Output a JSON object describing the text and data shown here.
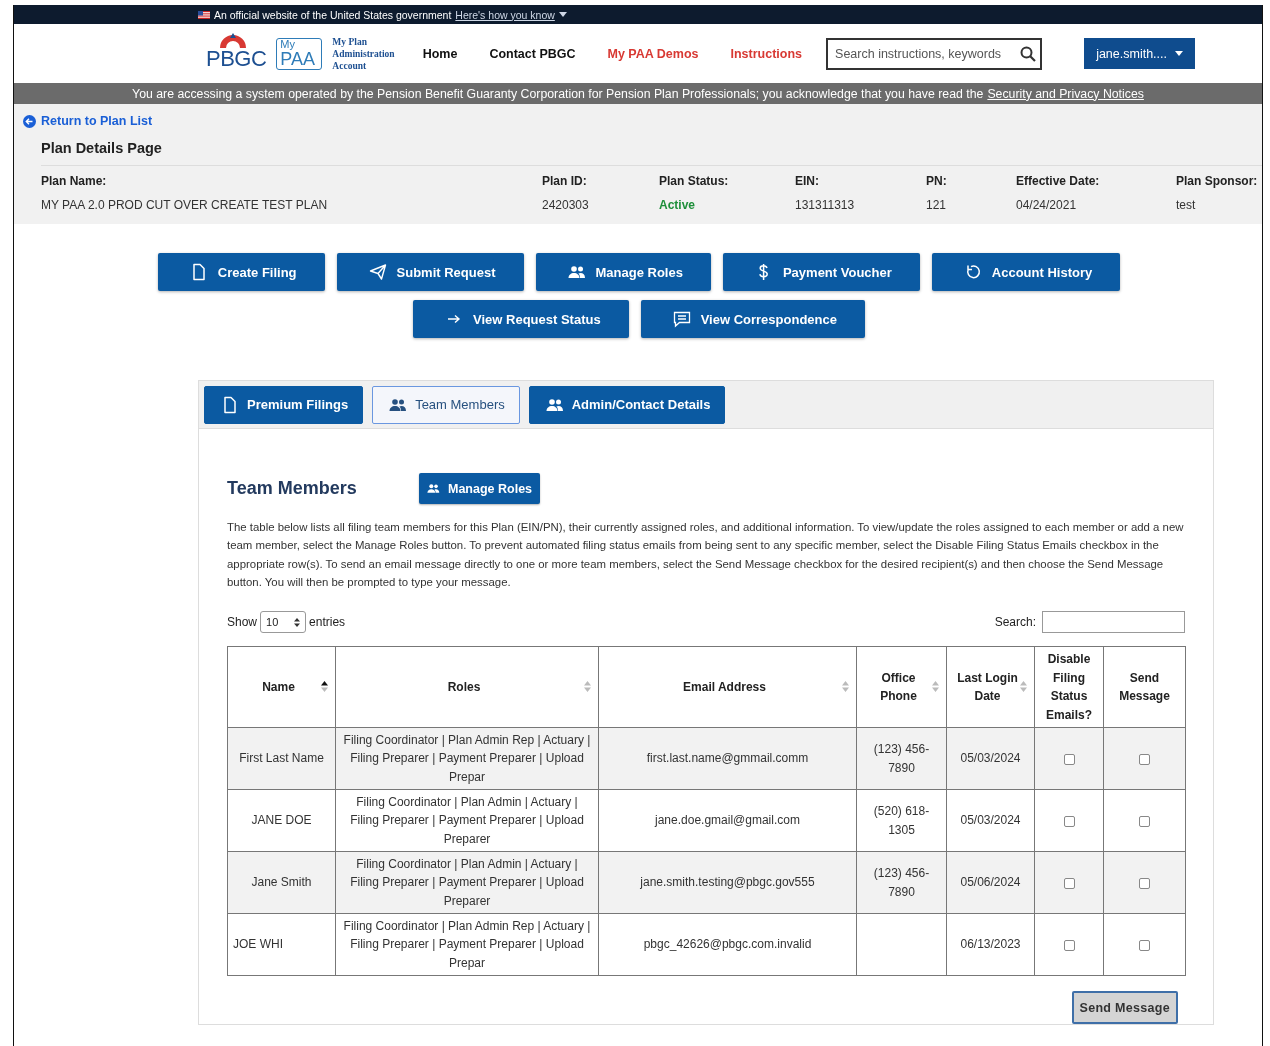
{
  "gov_banner": {
    "text": "An official website of the United States government",
    "link": "Here's how you know"
  },
  "header": {
    "logo_primary": "PBGC",
    "logo_secondary_top": "My",
    "logo_secondary_bottom": "PAA",
    "logo_caption": [
      "My Plan",
      "Administration",
      "Account"
    ],
    "nav": [
      {
        "label": "Home",
        "kind": "plain"
      },
      {
        "label": "Contact PBGC",
        "kind": "plain"
      },
      {
        "label": "My PAA Demos",
        "kind": "accent"
      },
      {
        "label": "Instructions",
        "kind": "accent"
      }
    ],
    "search": {
      "placeholder": "Search instructions, keywords"
    },
    "user_menu": "jane.smith...."
  },
  "notice": {
    "text": "You are accessing a system operated by the Pension Benefit Guaranty Corporation for Pension Plan Professionals; you acknowledge that you have read the",
    "link": "Security and Privacy Notices"
  },
  "back_link": "Return to Plan List",
  "page_title": "Plan Details Page",
  "plan_fields": [
    {
      "label": "Plan Name:",
      "value": "MY PAA 2.0 PROD CUT OVER CREATE TEST PLAN",
      "kind": "plain"
    },
    {
      "label": "Plan ID:",
      "value": "2420303",
      "kind": "plain"
    },
    {
      "label": "Plan Status:",
      "value": "Active",
      "kind": "status"
    },
    {
      "label": "EIN:",
      "value": "131311313",
      "kind": "plain"
    },
    {
      "label": "PN:",
      "value": "121",
      "kind": "plain"
    },
    {
      "label": "Effective Date:",
      "value": "04/24/2021",
      "kind": "plain"
    },
    {
      "label": "Plan Sponsor:",
      "value": "test",
      "kind": "plain"
    }
  ],
  "action_rows": [
    [
      "Create Filing",
      "Submit Request",
      "Manage Roles",
      "Payment Voucher",
      "Account History"
    ],
    [
      "View Request Status",
      "View Correspondence"
    ]
  ],
  "tabs": [
    {
      "label": "Premium Filings",
      "selected": false
    },
    {
      "label": "Team Members",
      "selected": true
    },
    {
      "label": "Admin/Contact Details",
      "selected": false
    }
  ],
  "section": {
    "title": "Team Members",
    "button": "Manage Roles",
    "description": "The table below lists all filing team members for this Plan (EIN/PN), their currently assigned roles, and additional information. To view/update the roles assigned to each member or add a new team member, select the Manage Roles button. To prevent automated filing status emails from being sent to any specific member, select the Disable Filing Status Emails checkbox in the appropriate row(s). To send an email message directly to one or more team members, select the Send Message checkbox for the desired recipient(s) and then choose the Send Message button. You will then be prompted to type your message."
  },
  "table_controls": {
    "show_label": "Show",
    "page_size": "10",
    "entries_label": "entries",
    "search_label": "Search:"
  },
  "table": {
    "columns": [
      {
        "label": "Name",
        "kind": "sorted"
      },
      {
        "label": "Roles",
        "kind": "sortable"
      },
      {
        "label": "Email Address",
        "kind": "sortable"
      },
      {
        "label": "Office Phone",
        "kind": "sortable"
      },
      {
        "label": "Last Login Date",
        "kind": "sortable"
      },
      {
        "label": "Disable Filing Status Emails?",
        "kind": "plain"
      },
      {
        "label": "Send Message",
        "kind": "plain"
      }
    ],
    "rows": [
      {
        "name": "First Last Name",
        "roles": "Filing Coordinator | Plan Admin Rep | Actuary | Filing Preparer | Payment Preparer | Upload Prepar",
        "email": "first.last.name@gmmail.comm",
        "phone": "(123) 456-7890",
        "last_login": "05/03/2024",
        "disable_emails": false,
        "send_message": false
      },
      {
        "name": "JANE DOE",
        "roles": "Filing Coordinator | Plan Admin | Actuary | Filing Preparer | Payment Preparer | Upload Preparer",
        "email": "jane.doe.gmail@gmail.com",
        "phone": "(520) 618-1305",
        "last_login": "05/03/2024",
        "disable_emails": false,
        "send_message": false
      },
      {
        "name": "Jane Smith",
        "roles": "Filing Coordinator | Plan Admin | Actuary | Filing Preparer | Payment Preparer | Upload Preparer",
        "email": "jane.smith.testing@pbgc.gov555",
        "phone": "(123) 456-7890",
        "last_login": "05/06/2024",
        "disable_emails": false,
        "send_message": false
      },
      {
        "name": "JOE WHI",
        "roles": "Filing Coordinator | Plan Admin Rep | Actuary | Filing Preparer | Payment Preparer | Upload Prepar",
        "email": "pbgc_42626@pbgc.com.invalid",
        "last_login": "06/13/2023",
        "disable_emails": false,
        "send_message": false
      }
    ]
  },
  "send_button": "Send Message"
}
